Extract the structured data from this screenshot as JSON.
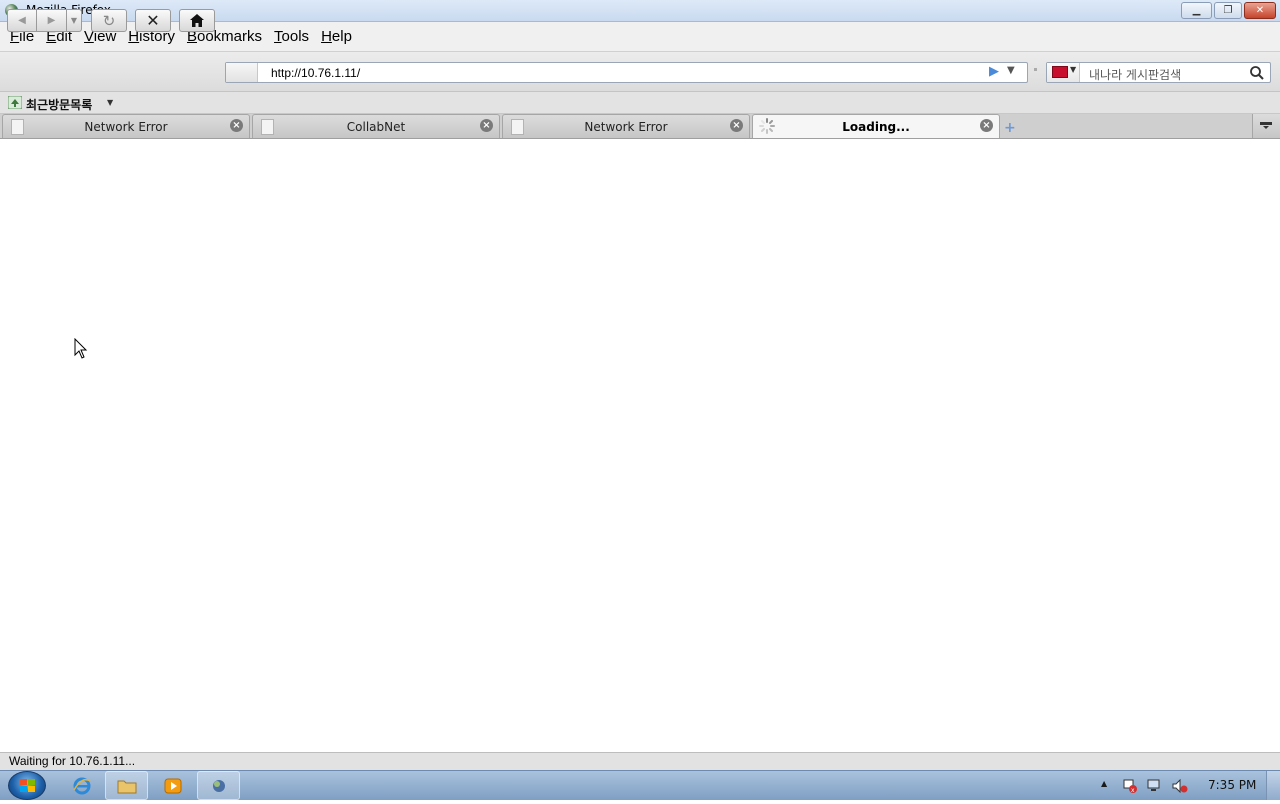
{
  "window": {
    "title": "Mozilla Firefox"
  },
  "menu": [
    "File",
    "Edit",
    "View",
    "History",
    "Bookmarks",
    "Tools",
    "Help"
  ],
  "address_bar": {
    "url": "http://10.76.1.11/"
  },
  "search": {
    "placeholder": "내나라 게시판검색"
  },
  "bookmarks_toolbar": {
    "label": "최근방문목록"
  },
  "tabs": [
    {
      "label": "Network Error",
      "loading": false
    },
    {
      "label": "CollabNet",
      "loading": false
    },
    {
      "label": "Network Error",
      "loading": false
    },
    {
      "label": "Loading...",
      "loading": true
    }
  ],
  "status": {
    "text": "Waiting for 10.76.1.11..."
  },
  "taskbar": {
    "clock": "7:35 PM"
  },
  "colors": {
    "accent_blue": "#4a8ad8",
    "close_red": "#c7432b",
    "taskbar": "#7f9fc3"
  }
}
